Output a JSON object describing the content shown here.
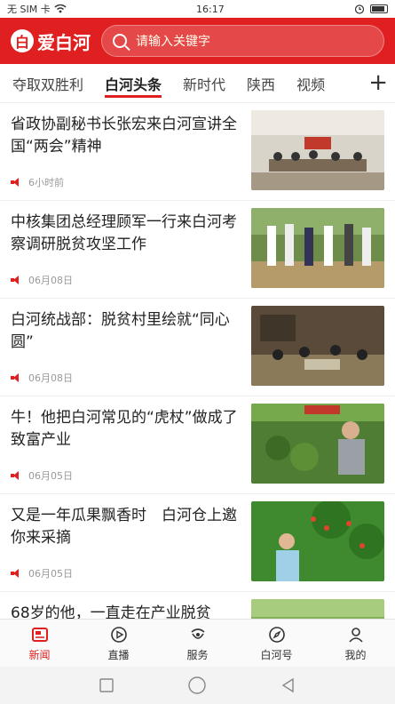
{
  "status": {
    "carrier": "无 SIM 卡",
    "time": "16:17"
  },
  "header": {
    "logo_text": "爱白河",
    "search_placeholder": "请输入关键字"
  },
  "tabs": [
    {
      "label": "夺取双胜利"
    },
    {
      "label": "白河头条",
      "active": true
    },
    {
      "label": "新时代"
    },
    {
      "label": "陕西"
    },
    {
      "label": "视频"
    }
  ],
  "feed": [
    {
      "title": "省政协副秘书长张宏来白河宣讲全国“两会”精神",
      "time": "6小时前",
      "thumb_icon": "meeting-photo"
    },
    {
      "title": "中核集团总经理顾军一行来白河考察调研脱贫攻坚工作",
      "time": "06月08日",
      "thumb_icon": "field-visit-photo"
    },
    {
      "title": "白河统战部：脱贫村里绘就“同心圆”",
      "time": "06月08日",
      "thumb_icon": "village-meeting-photo"
    },
    {
      "title": "牛！他把白河常见的“虎杖”做成了致富产业",
      "time": "06月05日",
      "thumb_icon": "plant-farmer-photo"
    },
    {
      "title": "又是一年瓜果飘香时　白河仓上邀你来采摘",
      "time": "06月05日",
      "thumb_icon": "fruit-picking-photo"
    },
    {
      "title": "68岁的他，一直走在产业脱贫",
      "time": "",
      "thumb_icon": "orchard-photo"
    }
  ],
  "tabbar": [
    {
      "label": "新闻",
      "active": true,
      "icon": "news-icon"
    },
    {
      "label": "直播",
      "icon": "live-icon"
    },
    {
      "label": "服务",
      "icon": "service-icon"
    },
    {
      "label": "白河号",
      "icon": "compass-icon"
    },
    {
      "label": "我的",
      "icon": "profile-icon"
    }
  ],
  "colors": {
    "brand": "#e02020"
  }
}
